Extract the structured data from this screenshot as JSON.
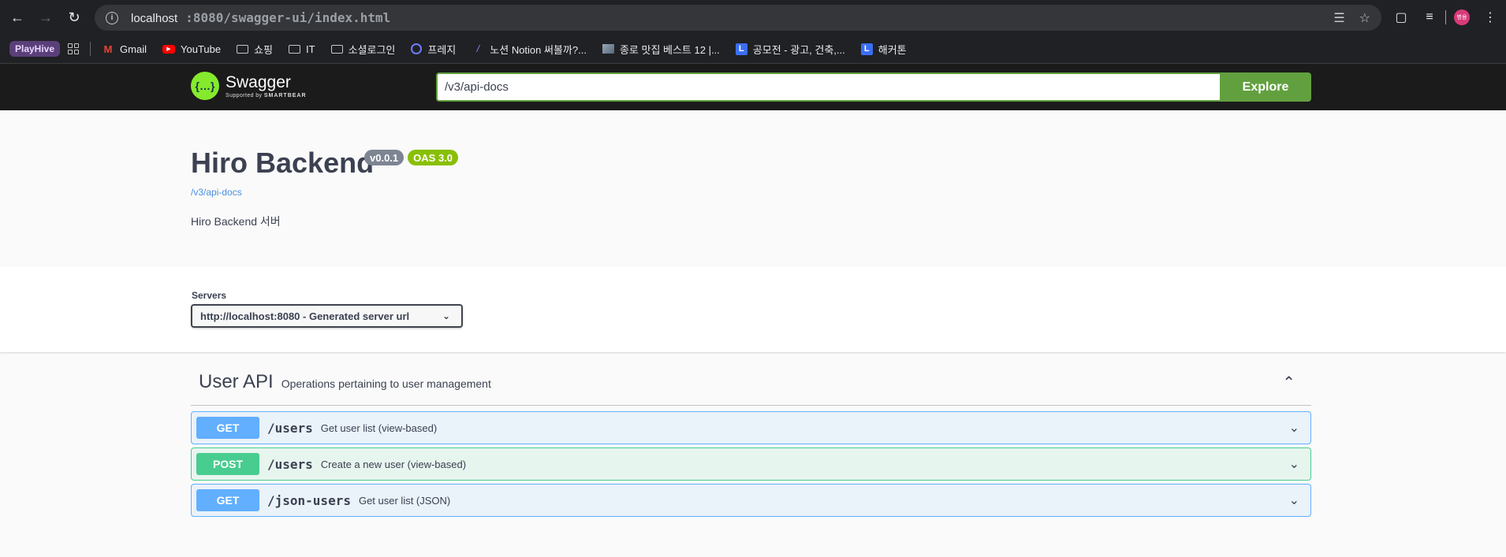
{
  "browser": {
    "url_host": "localhost",
    "url_path": ":8080/swagger-ui/index.html",
    "avatar_text": "병용"
  },
  "bookmarks": [
    {
      "label": "PlayHive",
      "icon": "playhive-badge"
    },
    {
      "label": "Gmail",
      "icon": "gmail-icon"
    },
    {
      "label": "YouTube",
      "icon": "youtube-icon"
    },
    {
      "label": "쇼핑",
      "icon": "folder-icon"
    },
    {
      "label": "IT",
      "icon": "folder-icon"
    },
    {
      "label": "소셜로그인",
      "icon": "folder-icon"
    },
    {
      "label": "프레지",
      "icon": "prezi-icon"
    },
    {
      "label": "노션 Notion 써볼까?...",
      "icon": "notion-icon"
    },
    {
      "label": "종로 맛집 베스트 12 |...",
      "icon": "image-icon"
    },
    {
      "label": "공모전 - 광고, 건축,...",
      "icon": "l-icon"
    },
    {
      "label": "해커톤",
      "icon": "l-icon"
    }
  ],
  "topbar": {
    "logo_text": "Swagger",
    "logo_sub": "Supported by",
    "logo_brand": "SMARTBEAR",
    "spec_url": "/v3/api-docs",
    "explore_label": "Explore"
  },
  "info": {
    "title": "Hiro Backend",
    "version": "v0.0.1",
    "oas": "OAS 3.0",
    "spec_link": "/v3/api-docs",
    "description": "Hiro Backend 서버"
  },
  "servers": {
    "label": "Servers",
    "selected": "http://localhost:8080 - Generated server url"
  },
  "tag": {
    "name": "User API",
    "description": "Operations pertaining to user management"
  },
  "operations": [
    {
      "method": "GET",
      "path": "/users",
      "summary": "Get user list (view-based)"
    },
    {
      "method": "POST",
      "path": "/users",
      "summary": "Create a new user (view-based)"
    },
    {
      "method": "GET",
      "path": "/json-users",
      "summary": "Get user list (JSON)"
    }
  ],
  "colors": {
    "get": "#61affe",
    "post": "#49cc90",
    "explore": "#62a03f",
    "oas_badge": "#89bf04"
  }
}
